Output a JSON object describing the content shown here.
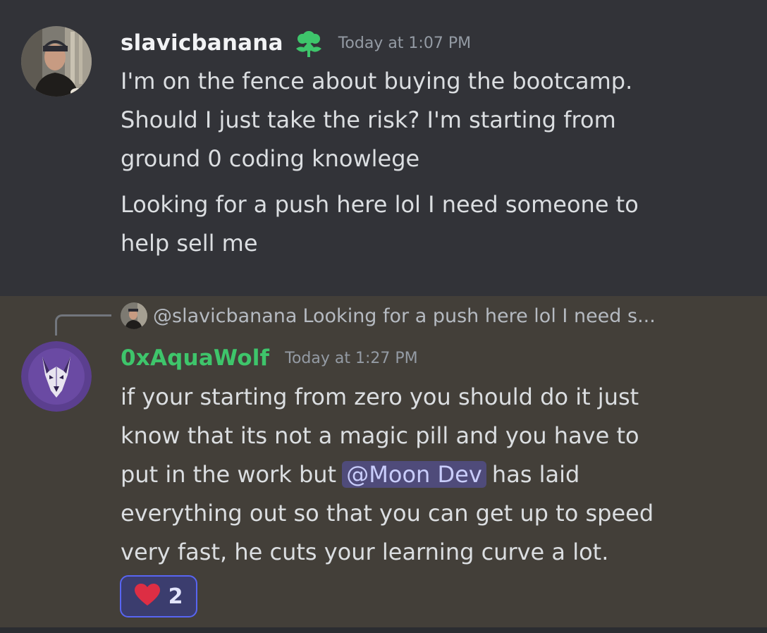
{
  "messages": [
    {
      "author": "slavicbanana",
      "timestamp": "Today at 1:07 PM",
      "role_icon": "green-flower-icon",
      "paragraphs": [
        [
          "I'm on the fence about buying the bootcamp.",
          "Should I just take the risk? I'm starting from",
          "ground 0 coding knowlege"
        ],
        [
          "Looking for a push here lol I need someone to",
          "help sell me"
        ]
      ]
    },
    {
      "author": "0xAquaWolf",
      "timestamp": "Today at 1:27 PM",
      "reply": {
        "user": "@slavicbanana",
        "text": "Looking for a push here lol I need s..."
      },
      "lines": {
        "l1": "if your starting from zero you should do it just",
        "l2": "know that its not a magic pill and you have to",
        "l3_before": "put in the work but ",
        "mention": "@Moon Dev",
        "l3_after": " has laid",
        "l4": "everything out so that you can get up to speed",
        "l5": "very fast, he cuts your learning curve a lot."
      },
      "reaction": {
        "emoji": "heart-icon",
        "count": "2"
      }
    }
  ],
  "colors": {
    "background": "#313338",
    "highlight_background": "#433f39",
    "username_green": "#3ec56b",
    "mention_bg": "#4f4b7a",
    "reaction_border": "#5865f2"
  }
}
